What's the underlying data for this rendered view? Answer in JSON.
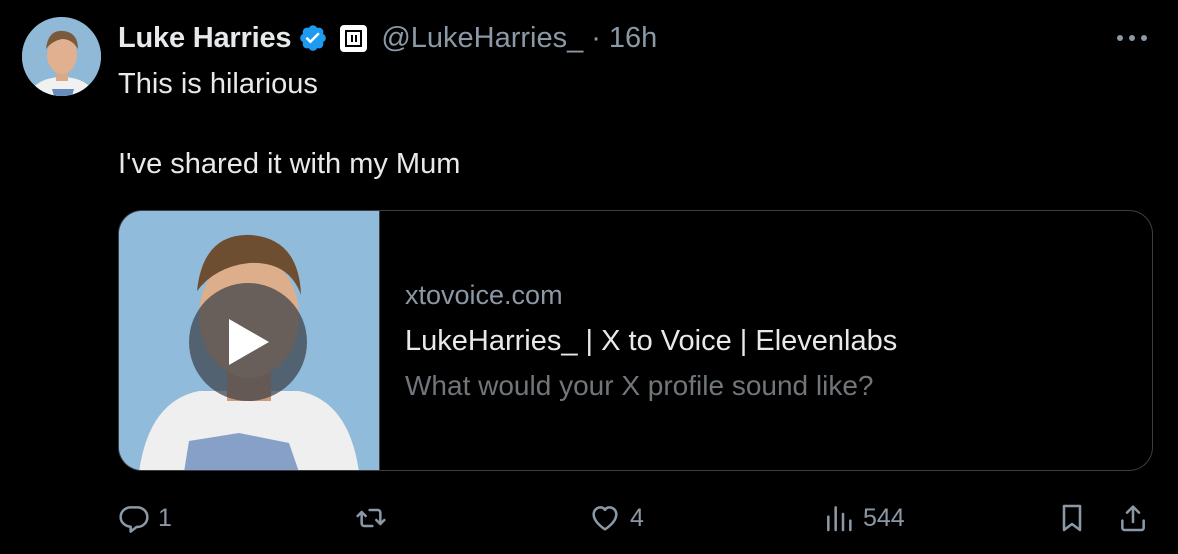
{
  "author": {
    "display_name": "Luke Harries",
    "handle": "@LukeHarries_",
    "separator": "·",
    "time": "16h",
    "verified": true,
    "verified_color": "#1d9bf0"
  },
  "tweet": {
    "line1": "This is hilarious",
    "line2": "I've shared it with my Mum"
  },
  "card": {
    "domain": "xtovoice.com",
    "title": "LukeHarries_ | X to Voice | Elevenlabs",
    "description": "What would your X profile sound like?",
    "media_icon": "play-icon"
  },
  "actions": {
    "replies": "1",
    "reposts": "",
    "likes": "4",
    "views": "544"
  },
  "icons": {
    "more": "more-icon",
    "reply": "reply-icon",
    "repost": "repost-icon",
    "like": "heart-icon",
    "views": "views-icon",
    "bookmark": "bookmark-icon",
    "share": "share-icon"
  }
}
